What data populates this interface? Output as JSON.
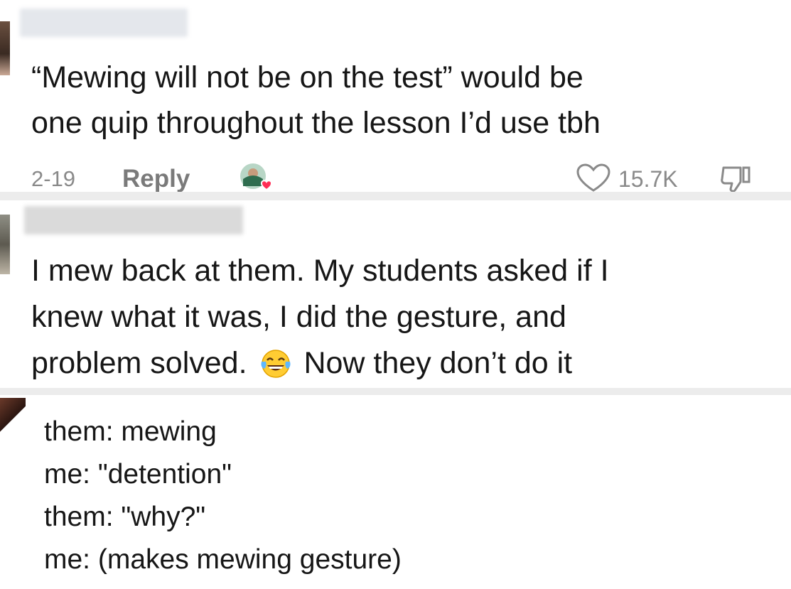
{
  "comments": [
    {
      "lines": [
        "“Mewing will not be on the test” would be",
        "one quip throughout the lesson I’d use tbh"
      ],
      "date": "2-19",
      "reply_label": "Reply",
      "likes": "15.7K"
    },
    {
      "line1": "I mew back at them. My students asked if I",
      "line2": "knew what it was, I did the gesture, and",
      "line3_before": "problem solved.",
      "line3_after": "Now they don’t do it",
      "emoji": "face-with-tears-of-joy"
    },
    {
      "lines": [
        "them: mewing",
        "me: \"detention\"",
        "them: \"why?\"",
        "me: (makes mewing gesture)"
      ]
    }
  ],
  "colors": {
    "meta_text": "#8a8a8a",
    "like_heart": "#8a8a8a",
    "divider": "#ececec",
    "liked_avatar_heart": "#ff2d55"
  }
}
